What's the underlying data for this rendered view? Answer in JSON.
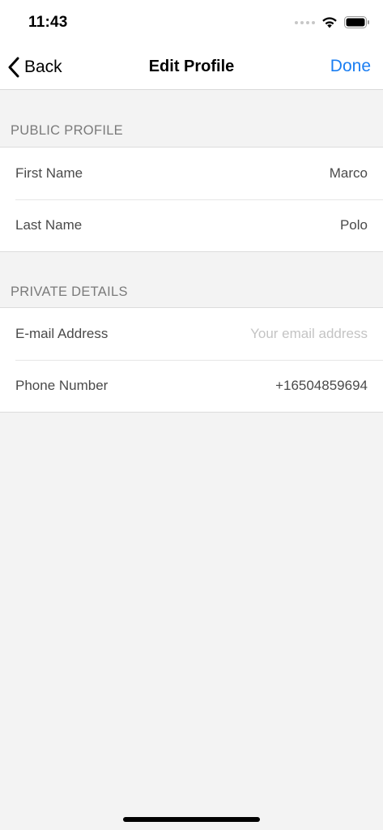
{
  "status_bar": {
    "time": "11:43"
  },
  "nav": {
    "back_label": "Back",
    "title": "Edit Profile",
    "done_label": "Done"
  },
  "sections": [
    {
      "header": "PUBLIC PROFILE",
      "rows": [
        {
          "label": "First Name",
          "value": "Marco",
          "placeholder": ""
        },
        {
          "label": "Last Name",
          "value": "Polo",
          "placeholder": ""
        }
      ]
    },
    {
      "header": "PRIVATE DETAILS",
      "rows": [
        {
          "label": "E-mail Address",
          "value": "",
          "placeholder": "Your email address"
        },
        {
          "label": "Phone Number",
          "value": "+16504859694",
          "placeholder": ""
        }
      ]
    }
  ],
  "colors": {
    "accent": "#1a7ef2",
    "background": "#f3f3f3",
    "cell_background": "#ffffff",
    "section_header_text": "#7a7a7a"
  }
}
